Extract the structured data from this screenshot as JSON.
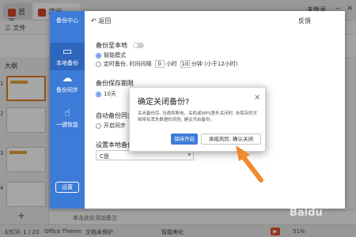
{
  "app": {
    "tabs": {
      "home": "首页",
      "doc": "演示"
    },
    "toolbar": {
      "menu_file": "三 文件"
    },
    "top_right": {
      "feedback": "反馈",
      "login": "未登录"
    },
    "panel_tabs": "大纲",
    "slide_numbers": [
      "1",
      "2",
      "3",
      "4"
    ],
    "add_slide": "+",
    "notes_placeholder": "单击此处添加备注",
    "status": {
      "slide_count": "幻灯片 1 / 20",
      "theme": "Office Theme",
      "doc_protect": "文档未保护",
      "smart_beautify": "智能美化",
      "zoom": "51%"
    }
  },
  "backup_center": {
    "brand": "备份中心",
    "back": "返回",
    "nav": [
      {
        "label": "本地备份",
        "icon": "computer-icon"
      },
      {
        "label": "备份同步",
        "icon": "cloud-upload-icon"
      },
      {
        "label": "一键恢复",
        "icon": "hand-pointer-icon"
      }
    ],
    "settings_button": "设置",
    "sections": {
      "local_backup": "备份至本地",
      "smart_mode": "智能模式",
      "timed_backup_prefix": "定时备份, 时间间隔",
      "hours_value": "0",
      "hours_unit": "小时",
      "minutes_value": "10",
      "minutes_unit": "分钟",
      "timed_backup_suffix": "(小于12小时)",
      "retention_title": "备份保存期限",
      "retention_value": "10天",
      "auto_sync_title": "自动备份同步",
      "auto_sync_toggle": "开启同步",
      "location_title": "设置本地备份",
      "location_value": "C盘"
    }
  },
  "dialog": {
    "title": "确定关闭备份?",
    "close": "×",
    "message": "关闭备份后, 当遇到断电、关机或WPS意外关闭时, 未保存的文档将有丢失数据的风险, 建议开启备份。",
    "primary_button": "保持开启",
    "secondary_button": "承担风险, 确认关闭"
  },
  "watermark": "Baidu",
  "colors": {
    "accent": "#3d7bd8",
    "arrow": "#f08a2c",
    "wps_red": "#d24726"
  }
}
